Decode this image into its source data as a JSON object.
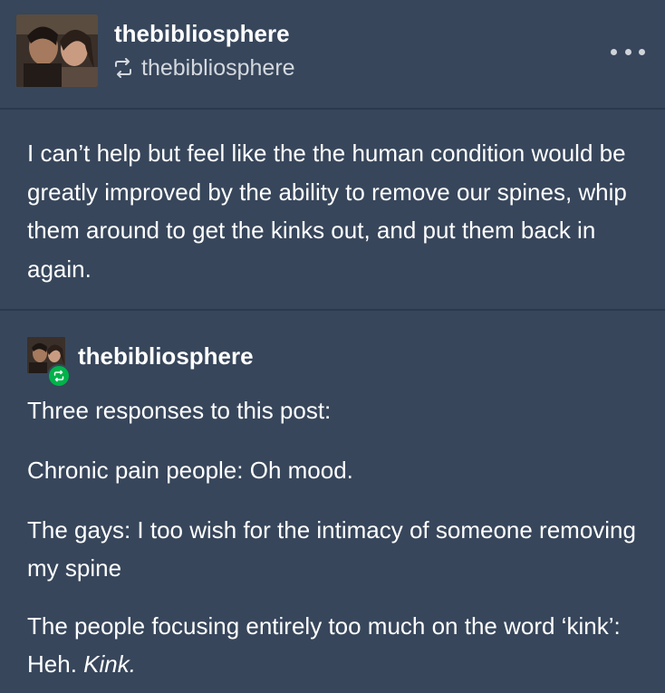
{
  "original_post": {
    "username": "thebibliosphere",
    "reblogged_from": "thebibliosphere",
    "text": "I can’t help but feel like the the human condition would be greatly improved by the ability to remove our spines, whip them around to get the kinks out, and put them back in again."
  },
  "reblog": {
    "username": "thebibliosphere",
    "lines": {
      "intro": "Three responses to this post:",
      "chronic": "Chronic pain people: Oh mood.",
      "gays": "The gays: I too wish for the intimacy of someone removing my spine",
      "kink_prefix": "The people focusing entirely too much on the word ‘kink’: Heh. ",
      "kink_italic": "Kink."
    }
  },
  "icons": {
    "more": "more-options-icon",
    "reblog": "reblog-icon",
    "badge": "reblog-badge-icon"
  },
  "colors": {
    "background": "#37465b",
    "divider": "#2c394b",
    "reblog_badge": "#00b34a",
    "secondary_text": "#d3d8de"
  }
}
